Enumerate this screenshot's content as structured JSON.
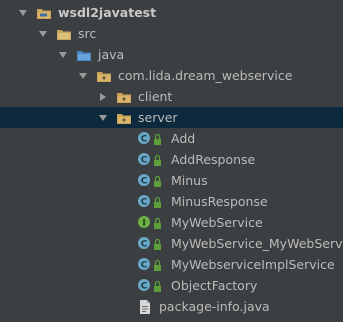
{
  "tree": {
    "project": {
      "label": "wsdl2javatest",
      "icon": "module-folder-icon"
    },
    "src": {
      "label": "src",
      "icon": "source-folder-icon"
    },
    "java": {
      "label": "java",
      "icon": "source-root-folder-icon"
    },
    "package": {
      "label": "com.lida.dream_webservice",
      "icon": "package-folder-icon"
    },
    "client": {
      "label": "client",
      "icon": "package-folder-icon"
    },
    "server": {
      "label": "server",
      "icon": "package-folder-icon"
    },
    "classes": [
      {
        "label": "Add",
        "icon": "class-icon"
      },
      {
        "label": "AddResponse",
        "icon": "class-icon"
      },
      {
        "label": "Minus",
        "icon": "class-icon"
      },
      {
        "label": "MinusResponse",
        "icon": "class-icon"
      },
      {
        "label": "MyWebService",
        "icon": "interface-icon"
      },
      {
        "label": "MyWebService_MyWebServic",
        "icon": "class-icon"
      },
      {
        "label": "MyWebserviceImplService",
        "icon": "class-icon"
      },
      {
        "label": "ObjectFactory",
        "icon": "class-icon"
      }
    ],
    "file": {
      "label": "package-info.java",
      "icon": "java-file-icon"
    }
  },
  "colors": {
    "background": "#3c3f41",
    "selection": "#0d293e",
    "class_icon": "#6aa8c8",
    "interface_icon": "#6ab045",
    "folder": "#c8a45a",
    "source_folder": "#5a9bd4",
    "lock": "#5b9e3a"
  }
}
